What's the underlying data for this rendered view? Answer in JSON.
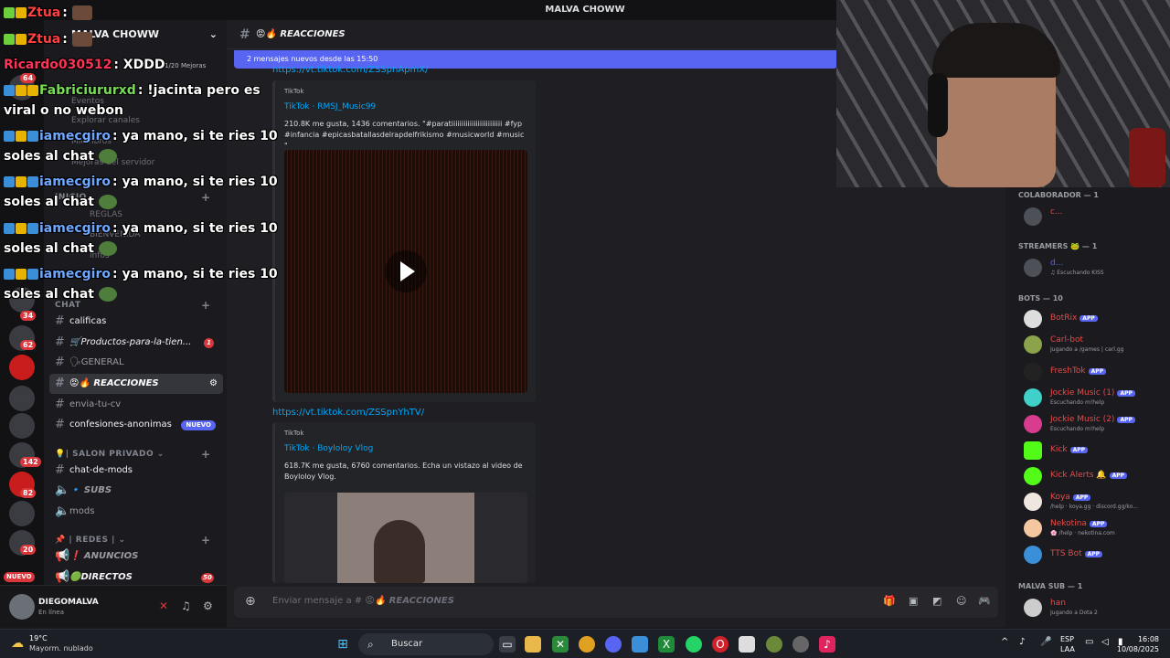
{
  "window": {
    "title": "MALVA CHOWW"
  },
  "server": {
    "name": "MALVA CHOWW",
    "boost": "1/20 Mejoras"
  },
  "sidebar": {
    "faded_items": [
      "Eventos",
      "Explorar canales",
      "Miembros",
      "Mejoras del servidor",
      "INICIO",
      "REGLAS",
      "BIENVENIDA",
      "infos",
      "CHAT"
    ],
    "channels": [
      {
        "label": "calificas"
      },
      {
        "label": "🛒Productos-para-la-tien...",
        "count": "1"
      },
      {
        "label": "🗣GENERAL"
      },
      {
        "label": "😡🔥 REACCIONES"
      },
      {
        "label": "envia-tu-cv"
      },
      {
        "label": "confesiones-anonimas",
        "badge": "NUEVO"
      },
      {
        "label": "chat-de-mods"
      },
      {
        "label": "🔹 SUBS"
      },
      {
        "label": "mods"
      },
      {
        "label": "❗ ANUNCIOS"
      },
      {
        "label": "🟢DIRECTOS",
        "count": "50"
      }
    ],
    "categories": [
      "💡| SALON PRIVADO ⌄",
      "📌 | REDES | ⌄"
    ]
  },
  "rail_badges": [
    "64",
    "34",
    "62",
    "142",
    "82",
    "20"
  ],
  "rail_new": "NUEVO",
  "user": {
    "name": "DIEGOMALVA",
    "status": "En línea"
  },
  "channel_header": {
    "name": "😡🔥 REACCIONES"
  },
  "new_messages_bar": "2 mensajes nuevos desde las 15:50",
  "messages": [
    {
      "link": "https://vt.tiktok.com/ZSSpnApmX/",
      "provider": "TikTok",
      "title": "TikTok · RMSJ_Music99",
      "description": "210.8K me gusta, 1436 comentarios. \"#paratiiiiiiiiiiiiiiiiiiiiiiiii #fyp #infancia #epicasbatallasdelrapdelfrikismo #musicworld #music \""
    },
    {
      "link": "https://vt.tiktok.com/ZSSpnYhTV/",
      "provider": "TikTok",
      "title": "TikTok · Boyloloy Vlog",
      "description": "618.7K me gusta, 6760 comentarios. Echa un vistazo al video de Boyloloy Vlog."
    }
  ],
  "composer": {
    "placeholder": "Enviar mensaje a #",
    "channel": "😡🔥 REACCIONES"
  },
  "members": {
    "groups": [
      {
        "title": "COLABORADOR — 1",
        "items": [
          {
            "name": "c...",
            "color": "#e34b4b",
            "sub": ""
          }
        ]
      },
      {
        "title": "STREAMERS 🐸 — 1",
        "items": [
          {
            "name": "d...",
            "color": "#5865f2",
            "sub": "♫ Escuchando KISS"
          }
        ]
      },
      {
        "title": "BOTS — 10",
        "items": [
          {
            "name": "BotRix",
            "color": "#e34b4b",
            "sub": "",
            "app": "APP"
          },
          {
            "name": "Carl-bot",
            "color": "#e34b4b",
            "sub": "Jugando a /games | carl.gg",
            "app": "APP"
          },
          {
            "name": "FreshTok",
            "color": "#e34b4b",
            "sub": "",
            "app": "APP"
          },
          {
            "name": "Jockie Music (1)",
            "color": "#e34b4b",
            "sub": "Escuchando m!help",
            "app": "APP"
          },
          {
            "name": "Jockie Music (2)",
            "color": "#e34b4b",
            "sub": "Escuchando m!help",
            "app": "APP"
          },
          {
            "name": "Kick",
            "color": "#e34b4b",
            "sub": "",
            "app": "APP"
          },
          {
            "name": "Kick Alerts 🔔",
            "color": "#e34b4b",
            "sub": "",
            "app": "APP"
          },
          {
            "name": "Koya",
            "color": "#e34b4b",
            "sub": "/help · koya.gg · discord.gg/ko...",
            "app": "APP"
          },
          {
            "name": "Nekotina",
            "color": "#e34b4b",
            "sub": "🌸 /help · nekotina.com",
            "app": "APP"
          },
          {
            "name": "TTS Bot",
            "color": "#e34b4b",
            "sub": "",
            "app": "APP"
          }
        ]
      },
      {
        "title": "MALVA SUB — 1",
        "items": [
          {
            "name": "han",
            "color": "#e34b4b",
            "sub": "Jugando a Dota 2"
          }
        ]
      }
    ]
  },
  "stream_chat": [
    {
      "user": "Ztua",
      "color": "#ff4040",
      "text": ":"
    },
    {
      "user": "Ztua",
      "color": "#ff4040",
      "text": ":"
    },
    {
      "user": "Ricardo030512",
      "color": "#ff3355",
      "text": ": XDDD"
    },
    {
      "user": "Fabriciururxd",
      "color": "#77dd55",
      "text": ": !jacinta pero es",
      "cont": "viral o no webon"
    },
    {
      "user": "iamecgiro",
      "color": "#6fa8ff",
      "text": ": ya mano, si te ries 10",
      "cont": "soles al chat"
    },
    {
      "user": "iamecgiro",
      "color": "#6fa8ff",
      "text": ": ya mano, si te ries 10",
      "cont": "soles al chat"
    },
    {
      "user": "iamecgiro",
      "color": "#6fa8ff",
      "text": ": ya mano, si te ries 10",
      "cont": "soles al chat"
    },
    {
      "user": "iamecgiro",
      "color": "#6fa8ff",
      "text": ": ya mano, si te ries 10",
      "cont": "soles al chat"
    }
  ],
  "taskbar": {
    "weather_temp": "19°C",
    "weather_desc": "Mayorm. nublado",
    "search": "Buscar",
    "lang": "ESP",
    "lang2": "LAA",
    "time": "16:08",
    "date": "10/08/2025"
  },
  "colors": {
    "accent": "#5865f2",
    "link": "#00a8fc",
    "danger": "#da373c"
  }
}
